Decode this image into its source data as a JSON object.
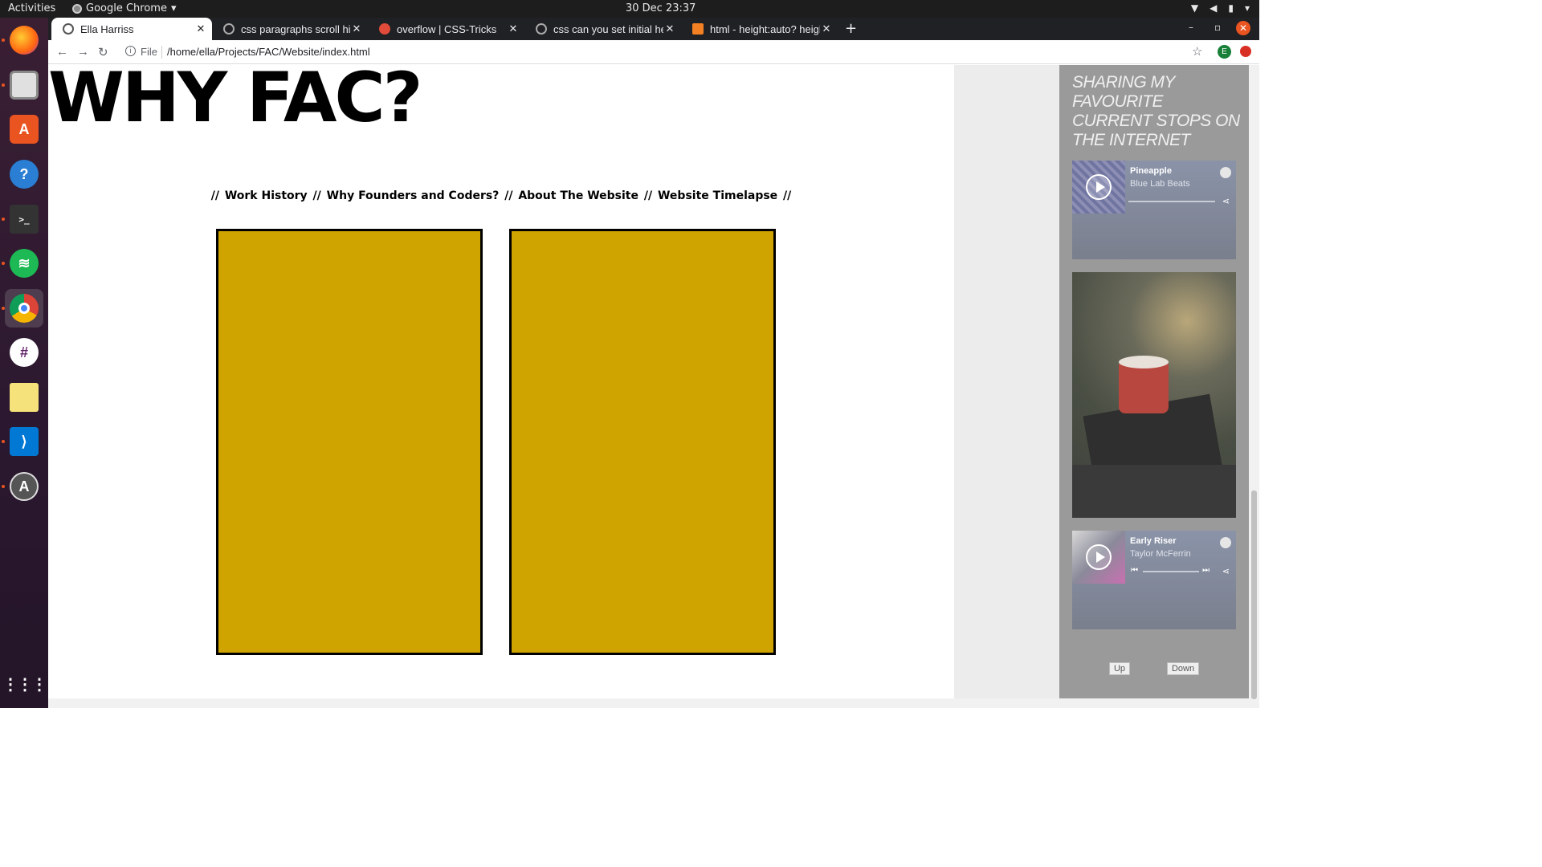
{
  "system": {
    "activities": "Activities",
    "app_name": "Google Chrome",
    "clock": "30 Dec  23:37"
  },
  "dock": {
    "items": [
      "firefox",
      "files",
      "software-center",
      "help",
      "terminal",
      "spotify",
      "chrome",
      "slack",
      "notes",
      "vscode",
      "updater",
      "app-grid"
    ]
  },
  "browser": {
    "tabs": [
      {
        "label": "Ella Harriss",
        "active": true
      },
      {
        "label": "css paragraphs scroll hidden",
        "active": false
      },
      {
        "label": "overflow | CSS-Tricks",
        "active": false
      },
      {
        "label": "css can you set initial height",
        "active": false
      },
      {
        "label": "html - height:auto? height",
        "active": false
      }
    ],
    "new_tab": "+",
    "file_label": "File",
    "url": "/home/ella/Projects/FAC/Website/index.html",
    "profile_initial": "E"
  },
  "page": {
    "heading": "WHY FAC?",
    "nav": {
      "sep": "//",
      "links": [
        "Work History",
        "Why Founders and Coders?",
        "About The Website",
        "Website Timelapse"
      ]
    },
    "card_color": "#cfa300"
  },
  "sidebar": {
    "title": "SHARING MY FAVOURITE CURRENT STOPS ON THE INTERNET",
    "players": [
      {
        "title": "Pineapple",
        "artist": "Blue Lab Beats"
      },
      {
        "title": "Early Riser",
        "artist": "Taylor McFerrin"
      }
    ],
    "up_label": "Up",
    "down_label": "Down"
  }
}
